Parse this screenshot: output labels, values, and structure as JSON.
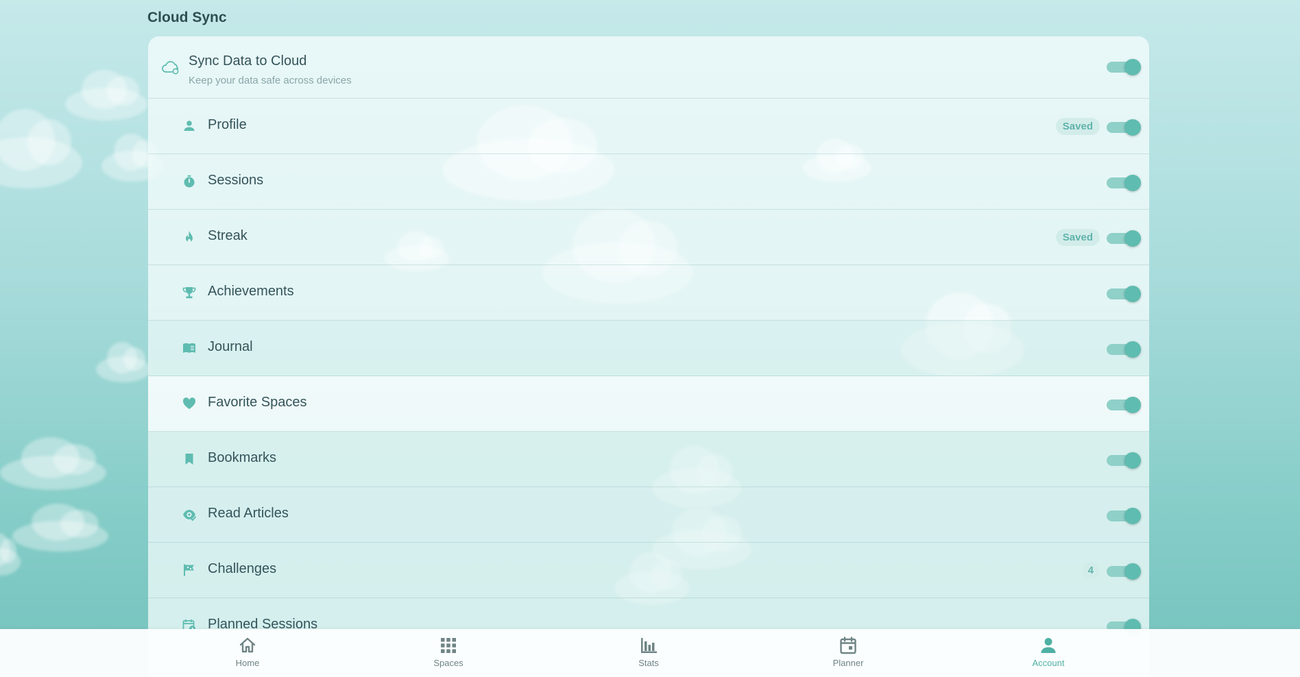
{
  "section": {
    "title": "Cloud Sync"
  },
  "master": {
    "title": "Sync Data to Cloud",
    "subtitle": "Keep your data safe across devices",
    "enabled": true
  },
  "items": [
    {
      "label": "Profile",
      "icon": "person-icon",
      "badge": "Saved",
      "enabled": true
    },
    {
      "label": "Sessions",
      "icon": "timer-icon",
      "badge": "",
      "enabled": true
    },
    {
      "label": "Streak",
      "icon": "flame-icon",
      "badge": "Saved",
      "enabled": true
    },
    {
      "label": "Achievements",
      "icon": "trophy-icon",
      "badge": "",
      "enabled": true
    },
    {
      "label": "Journal",
      "icon": "book-icon",
      "badge": "",
      "enabled": true
    },
    {
      "label": "Favorite Spaces",
      "icon": "heart-icon",
      "badge": "",
      "enabled": true
    },
    {
      "label": "Bookmarks",
      "icon": "bookmark-icon",
      "badge": "",
      "enabled": true
    },
    {
      "label": "Read Articles",
      "icon": "eye-check-icon",
      "badge": "",
      "enabled": true
    },
    {
      "label": "Challenges",
      "icon": "flag-icon",
      "badge": "4",
      "enabled": true
    },
    {
      "label": "Planned Sessions",
      "icon": "calendar-clock-icon",
      "badge": "",
      "enabled": true
    }
  ],
  "nav": {
    "home": "Home",
    "spaces": "Spaces",
    "stats": "Stats",
    "planner": "Planner",
    "account": "Account",
    "active": "account"
  },
  "colors": {
    "accent": "#5fbcb0",
    "text": "#34545a",
    "muted": "#8aa6a8"
  }
}
